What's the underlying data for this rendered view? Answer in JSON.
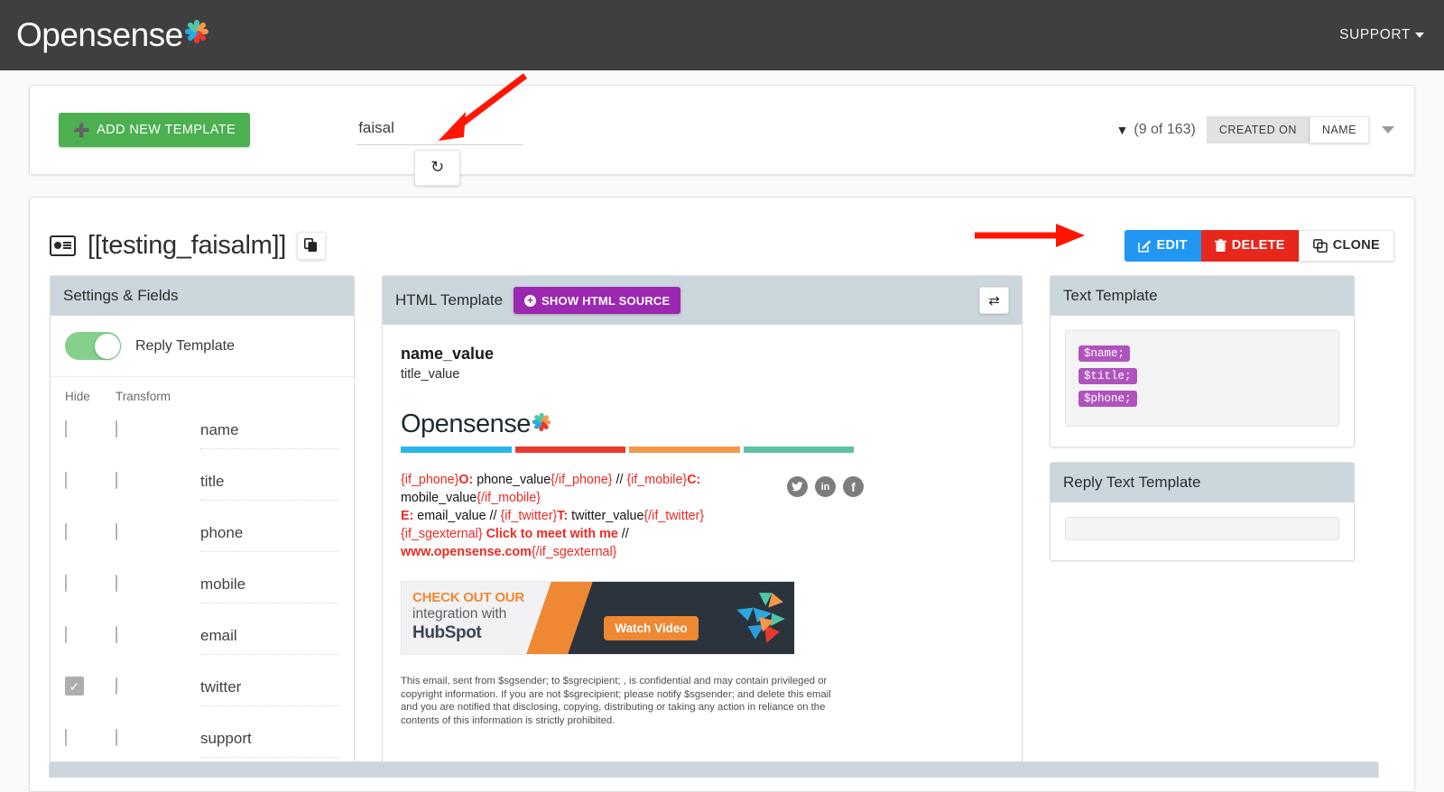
{
  "header": {
    "brand": "Opensense",
    "brand_icon": "opensense-asterisk-logo",
    "support_label": "SUPPORT",
    "support_caret_icon": "chevron-down-icon",
    "bg_color": "#3f3f3f"
  },
  "toolbar": {
    "add_template_label": "ADD NEW TEMPLATE",
    "add_template_icon": "plus-icon",
    "add_template_color": "#4caf50",
    "search_value": "faisal",
    "search_placeholder": "Search templates",
    "reset_icon": "undo-reset-icon",
    "filter_icon": "filter-icon",
    "count_label": "(9 of 163)",
    "sort_created_label": "CREATED ON",
    "sort_name_label": "NAME",
    "sort_active": "NAME",
    "expand_icon": "chevron-down-icon"
  },
  "template": {
    "icon": "contact-card-icon",
    "title": "[[testing_faisalm]]",
    "copy_icon": "copy-icon",
    "actions": {
      "edit_label": "EDIT",
      "edit_icon": "pencil-square-icon",
      "edit_color": "#2196f3",
      "delete_label": "DELETE",
      "delete_icon": "trash-icon",
      "delete_color": "#e8271c",
      "clone_label": "CLONE",
      "clone_icon": "clone-icon"
    }
  },
  "settings_panel": {
    "title": "Settings & Fields",
    "toggle_label": "Reply Template",
    "toggle_on": true,
    "toggle_color": "#86cf8c",
    "col_hide": "Hide",
    "col_transform": "Transform",
    "fields": [
      {
        "name": "name",
        "hide": false,
        "transform": false
      },
      {
        "name": "title",
        "hide": false,
        "transform": false
      },
      {
        "name": "phone",
        "hide": false,
        "transform": false
      },
      {
        "name": "mobile",
        "hide": false,
        "transform": false
      },
      {
        "name": "email",
        "hide": false,
        "transform": false
      },
      {
        "name": "twitter",
        "hide": true,
        "transform": false
      },
      {
        "name": "support",
        "hide": false,
        "transform": false
      }
    ]
  },
  "html_panel": {
    "title": "HTML Template",
    "show_source_label": "SHOW HTML SOURCE",
    "show_source_icon": "plus-circle-icon",
    "show_source_color": "#9c27b0",
    "refresh_icon": "refresh-icon",
    "signature": {
      "name": "name_value",
      "title": "title_value",
      "logo_text": "Opensense",
      "bar_colors": [
        "#29b6e8",
        "#e8392f",
        "#f2994a",
        "#5fc0a6"
      ],
      "lines": [
        {
          "parts": [
            {
              "t": "{if_phone}",
              "s": "r"
            },
            {
              "t": "O:",
              "s": "rb"
            },
            {
              "t": " phone_value",
              "s": "k"
            },
            {
              "t": "{/if_phone}",
              "s": "r"
            },
            {
              "t": " // ",
              "s": "k"
            },
            {
              "t": " {if_mobile}",
              "s": "r"
            },
            {
              "t": "C:",
              "s": "rb"
            },
            {
              "t": " mobile_value",
              "s": "k"
            },
            {
              "t": "{/if_mobile}",
              "s": "r"
            }
          ]
        },
        {
          "parts": [
            {
              "t": "E:",
              "s": "rb"
            },
            {
              "t": " email_value",
              "s": "k"
            },
            {
              "t": "  // ",
              "s": "k"
            },
            {
              "t": "{if_twitter}",
              "s": "r"
            },
            {
              "t": "T:",
              "s": "rb"
            },
            {
              "t": " twitter_value",
              "s": "k"
            },
            {
              "t": "{/if_twitter}",
              "s": "r"
            }
          ]
        },
        {
          "parts": [
            {
              "t": "{if_sgexternal}",
              "s": "r"
            },
            {
              "t": " Click to meet with me",
              "s": "rb"
            },
            {
              "t": "  // ",
              "s": "k"
            },
            {
              "t": "www.opensense.com",
              "s": "rb"
            },
            {
              "t": "{/if_sgexternal}",
              "s": "r"
            }
          ]
        }
      ],
      "social_icons": [
        "twitter-icon",
        "linkedin-icon",
        "facebook-icon"
      ],
      "social_glyphs": [
        "•",
        "in",
        "f"
      ],
      "banner": {
        "line1": "CHECK OUT OUR",
        "line2": "integration with",
        "line3": "HubSpot",
        "cta_label": "Watch Video",
        "cta_color": "#ef8833",
        "logo_icon": "hubspot-sprocket-icon"
      },
      "disclaimer": "This email, sent from $sgsender; to $sgrecipient; , is confidential and may contain privileged or copyright information. If you are not $sgrecipient; please notify $sgsender; and delete this email and you are notified that disclosing, copying, distributing or taking any action in reliance on the contents of this information is strictly prohibited."
    }
  },
  "text_panel": {
    "title": "Text Template",
    "variables": [
      "$name;",
      "$title;",
      "$phone;"
    ],
    "chip_color": "#b054bd"
  },
  "reply_text_panel": {
    "title": "Reply Text Template",
    "value": ""
  },
  "annotations": {
    "arrow_color": "#ff1500",
    "arrow_search_target": "search-input",
    "arrow_actions_target": "edit-button"
  }
}
